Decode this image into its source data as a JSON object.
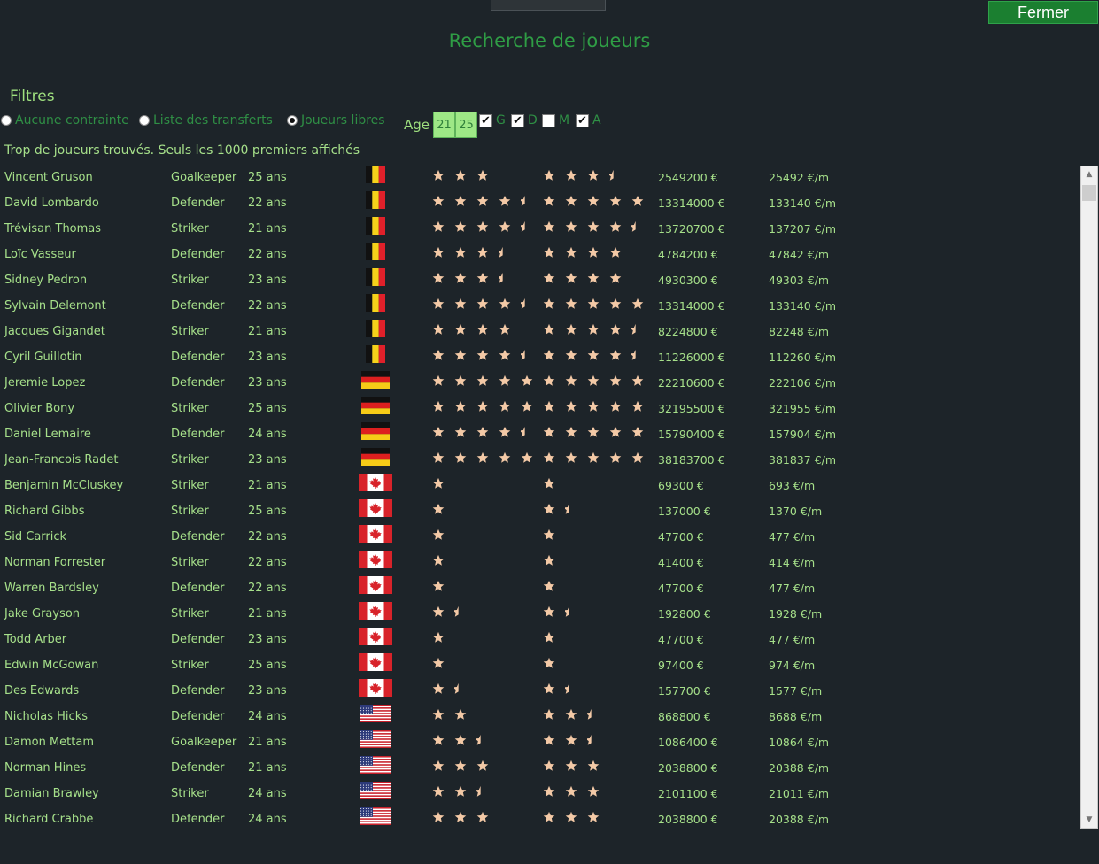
{
  "window": {
    "title": "Recherche de joueurs",
    "close_label": "Fermer"
  },
  "filters": {
    "label": "Filtres",
    "radios": [
      {
        "label": "Aucune contrainte",
        "selected": false
      },
      {
        "label": "Liste des transferts",
        "selected": false
      },
      {
        "label": "Joueurs libres",
        "selected": true
      }
    ],
    "age_label": "Age",
    "age_min": "21",
    "age_max": "25",
    "positions": [
      {
        "label": "G",
        "checked": true
      },
      {
        "label": "D",
        "checked": true
      },
      {
        "label": "M",
        "checked": false
      },
      {
        "label": "A",
        "checked": true
      }
    ]
  },
  "info_text": "Trop de joueurs trouvés. Seuls les 1000 premiers affichés",
  "colors": {
    "star": "#f3c9a6",
    "accent": "#1b7f30"
  },
  "players": [
    {
      "name": "Vincent Gruson",
      "position": "Goalkeeper",
      "age": "25 ans",
      "flag": "belgium",
      "stars1": 3,
      "stars2": 3.5,
      "value": "2549200 €",
      "salary": "25492 €/m"
    },
    {
      "name": "David Lombardo",
      "position": "Defender",
      "age": "22 ans",
      "flag": "belgium",
      "stars1": 4.5,
      "stars2": 5,
      "value": "13314000 €",
      "salary": "133140 €/m"
    },
    {
      "name": "Trévisan Thomas",
      "position": "Striker",
      "age": "21 ans",
      "flag": "belgium",
      "stars1": 4.5,
      "stars2": 4.5,
      "value": "13720700 €",
      "salary": "137207 €/m"
    },
    {
      "name": "Loïc Vasseur",
      "position": "Defender",
      "age": "22 ans",
      "flag": "belgium",
      "stars1": 3.5,
      "stars2": 4,
      "value": "4784200 €",
      "salary": "47842 €/m"
    },
    {
      "name": "Sidney Pedron",
      "position": "Striker",
      "age": "23 ans",
      "flag": "belgium",
      "stars1": 3.5,
      "stars2": 4,
      "value": "4930300 €",
      "salary": "49303 €/m"
    },
    {
      "name": "Sylvain Delemont",
      "position": "Defender",
      "age": "22 ans",
      "flag": "belgium",
      "stars1": 4.5,
      "stars2": 5,
      "value": "13314000 €",
      "salary": "133140 €/m"
    },
    {
      "name": "Jacques Gigandet",
      "position": "Striker",
      "age": "21 ans",
      "flag": "belgium",
      "stars1": 4,
      "stars2": 4.5,
      "value": "8224800 €",
      "salary": "82248 €/m"
    },
    {
      "name": "Cyril Guillotin",
      "position": "Defender",
      "age": "23 ans",
      "flag": "belgium",
      "stars1": 4.5,
      "stars2": 4.5,
      "value": "11226000 €",
      "salary": "112260 €/m"
    },
    {
      "name": "Jeremie Lopez",
      "position": "Defender",
      "age": "23 ans",
      "flag": "germany",
      "stars1": 5,
      "stars2": 5,
      "value": "22210600 €",
      "salary": "222106 €/m"
    },
    {
      "name": "Olivier Bony",
      "position": "Striker",
      "age": "25 ans",
      "flag": "germany",
      "stars1": 5,
      "stars2": 5,
      "value": "32195500 €",
      "salary": "321955 €/m"
    },
    {
      "name": "Daniel Lemaire",
      "position": "Defender",
      "age": "24 ans",
      "flag": "germany",
      "stars1": 4.5,
      "stars2": 5,
      "value": "15790400 €",
      "salary": "157904 €/m"
    },
    {
      "name": "Jean-Francois Radet",
      "position": "Striker",
      "age": "23 ans",
      "flag": "germany",
      "stars1": 5,
      "stars2": 5,
      "value": "38183700 €",
      "salary": "381837 €/m"
    },
    {
      "name": "Benjamin McCluskey",
      "position": "Striker",
      "age": "21 ans",
      "flag": "canada",
      "stars1": 1,
      "stars2": 1,
      "value": "69300 €",
      "salary": "693 €/m"
    },
    {
      "name": "Richard Gibbs",
      "position": "Striker",
      "age": "25 ans",
      "flag": "canada",
      "stars1": 1,
      "stars2": 1.5,
      "value": "137000 €",
      "salary": "1370 €/m"
    },
    {
      "name": "Sid Carrick",
      "position": "Defender",
      "age": "22 ans",
      "flag": "canada",
      "stars1": 1,
      "stars2": 1,
      "value": "47700 €",
      "salary": "477 €/m"
    },
    {
      "name": "Norman Forrester",
      "position": "Striker",
      "age": "22 ans",
      "flag": "canada",
      "stars1": 1,
      "stars2": 1,
      "value": "41400 €",
      "salary": "414 €/m"
    },
    {
      "name": "Warren Bardsley",
      "position": "Defender",
      "age": "22 ans",
      "flag": "canada",
      "stars1": 1,
      "stars2": 1,
      "value": "47700 €",
      "salary": "477 €/m"
    },
    {
      "name": "Jake Grayson",
      "position": "Striker",
      "age": "21 ans",
      "flag": "canada",
      "stars1": 1.5,
      "stars2": 1.5,
      "value": "192800 €",
      "salary": "1928 €/m"
    },
    {
      "name": "Todd Arber",
      "position": "Defender",
      "age": "23 ans",
      "flag": "canada",
      "stars1": 1,
      "stars2": 1,
      "value": "47700 €",
      "salary": "477 €/m"
    },
    {
      "name": "Edwin McGowan",
      "position": "Striker",
      "age": "25 ans",
      "flag": "canada",
      "stars1": 1,
      "stars2": 1,
      "value": "97400 €",
      "salary": "974 €/m"
    },
    {
      "name": "Des Edwards",
      "position": "Defender",
      "age": "23 ans",
      "flag": "canada",
      "stars1": 1.5,
      "stars2": 1.5,
      "value": "157700 €",
      "salary": "1577 €/m"
    },
    {
      "name": "Nicholas Hicks",
      "position": "Defender",
      "age": "24 ans",
      "flag": "usa",
      "stars1": 2,
      "stars2": 2.5,
      "value": "868800 €",
      "salary": "8688 €/m"
    },
    {
      "name": "Damon Mettam",
      "position": "Goalkeeper",
      "age": "21 ans",
      "flag": "usa",
      "stars1": 2.5,
      "stars2": 2.5,
      "value": "1086400 €",
      "salary": "10864 €/m"
    },
    {
      "name": "Norman Hines",
      "position": "Defender",
      "age": "21 ans",
      "flag": "usa",
      "stars1": 3,
      "stars2": 3,
      "value": "2038800 €",
      "salary": "20388 €/m"
    },
    {
      "name": "Damian Brawley",
      "position": "Striker",
      "age": "24 ans",
      "flag": "usa",
      "stars1": 2.5,
      "stars2": 3,
      "value": "2101100 €",
      "salary": "21011 €/m"
    },
    {
      "name": "Richard Crabbe",
      "position": "Defender",
      "age": "24 ans",
      "flag": "usa",
      "stars1": 3,
      "stars2": 3,
      "value": "2038800 €",
      "salary": "20388 €/m"
    }
  ]
}
